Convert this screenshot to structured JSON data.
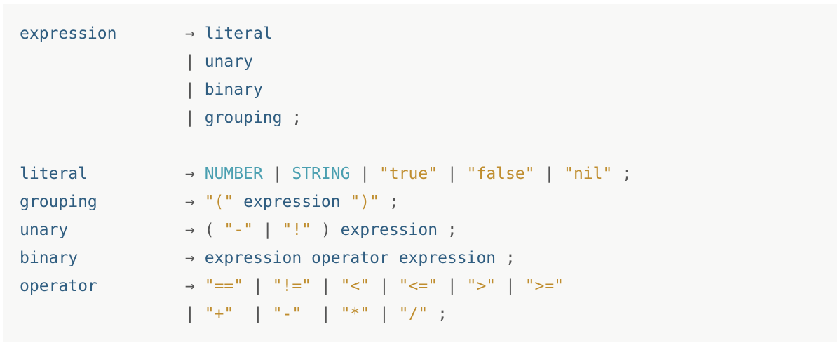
{
  "grammar": {
    "rules": [
      {
        "name": "expression",
        "lines": [
          [
            {
              "t": "punc",
              "v": "→ "
            },
            {
              "t": "nt",
              "v": "literal"
            }
          ],
          [
            {
              "t": "punc",
              "v": "| "
            },
            {
              "t": "nt",
              "v": "unary"
            }
          ],
          [
            {
              "t": "punc",
              "v": "| "
            },
            {
              "t": "nt",
              "v": "binary"
            }
          ],
          [
            {
              "t": "punc",
              "v": "| "
            },
            {
              "t": "nt",
              "v": "grouping"
            },
            {
              "t": "punc",
              "v": " ;"
            }
          ]
        ]
      },
      {
        "name": "",
        "lines": [
          []
        ]
      },
      {
        "name": "literal",
        "lines": [
          [
            {
              "t": "punc",
              "v": "→ "
            },
            {
              "t": "tok",
              "v": "NUMBER"
            },
            {
              "t": "punc",
              "v": " | "
            },
            {
              "t": "tok",
              "v": "STRING"
            },
            {
              "t": "punc",
              "v": " | "
            },
            {
              "t": "str",
              "v": "\"true\""
            },
            {
              "t": "punc",
              "v": " | "
            },
            {
              "t": "str",
              "v": "\"false\""
            },
            {
              "t": "punc",
              "v": " | "
            },
            {
              "t": "str",
              "v": "\"nil\""
            },
            {
              "t": "punc",
              "v": " ;"
            }
          ]
        ]
      },
      {
        "name": "grouping",
        "lines": [
          [
            {
              "t": "punc",
              "v": "→ "
            },
            {
              "t": "str",
              "v": "\"(\""
            },
            {
              "t": "punc",
              "v": " "
            },
            {
              "t": "nt",
              "v": "expression"
            },
            {
              "t": "punc",
              "v": " "
            },
            {
              "t": "str",
              "v": "\")\""
            },
            {
              "t": "punc",
              "v": " ;"
            }
          ]
        ]
      },
      {
        "name": "unary",
        "lines": [
          [
            {
              "t": "punc",
              "v": "→ ( "
            },
            {
              "t": "str",
              "v": "\"-\""
            },
            {
              "t": "punc",
              "v": " | "
            },
            {
              "t": "str",
              "v": "\"!\""
            },
            {
              "t": "punc",
              "v": " ) "
            },
            {
              "t": "nt",
              "v": "expression"
            },
            {
              "t": "punc",
              "v": " ;"
            }
          ]
        ]
      },
      {
        "name": "binary",
        "lines": [
          [
            {
              "t": "punc",
              "v": "→ "
            },
            {
              "t": "nt",
              "v": "expression"
            },
            {
              "t": "punc",
              "v": " "
            },
            {
              "t": "nt",
              "v": "operator"
            },
            {
              "t": "punc",
              "v": " "
            },
            {
              "t": "nt",
              "v": "expression"
            },
            {
              "t": "punc",
              "v": " ;"
            }
          ]
        ]
      },
      {
        "name": "operator",
        "lines": [
          [
            {
              "t": "punc",
              "v": "→ "
            },
            {
              "t": "str",
              "v": "\"==\""
            },
            {
              "t": "punc",
              "v": " | "
            },
            {
              "t": "str",
              "v": "\"!=\""
            },
            {
              "t": "punc",
              "v": " | "
            },
            {
              "t": "str",
              "v": "\"<\""
            },
            {
              "t": "punc",
              "v": " | "
            },
            {
              "t": "str",
              "v": "\"<=\""
            },
            {
              "t": "punc",
              "v": " | "
            },
            {
              "t": "str",
              "v": "\">\""
            },
            {
              "t": "punc",
              "v": " | "
            },
            {
              "t": "str",
              "v": "\">=\""
            }
          ],
          [
            {
              "t": "punc",
              "v": "| "
            },
            {
              "t": "str",
              "v": "\"+\""
            },
            {
              "t": "punc",
              "v": "  | "
            },
            {
              "t": "str",
              "v": "\"-\""
            },
            {
              "t": "punc",
              "v": "  | "
            },
            {
              "t": "str",
              "v": "\"*\""
            },
            {
              "t": "punc",
              "v": " | "
            },
            {
              "t": "str",
              "v": "\"/\""
            },
            {
              "t": "punc",
              "v": " ;"
            }
          ]
        ]
      }
    ]
  },
  "colors": {
    "nonterminal": "#2f5d80",
    "token": "#4a9fb0",
    "string": "#bf8d2e",
    "punctuation": "#555555",
    "background": "#f8f8f7"
  }
}
